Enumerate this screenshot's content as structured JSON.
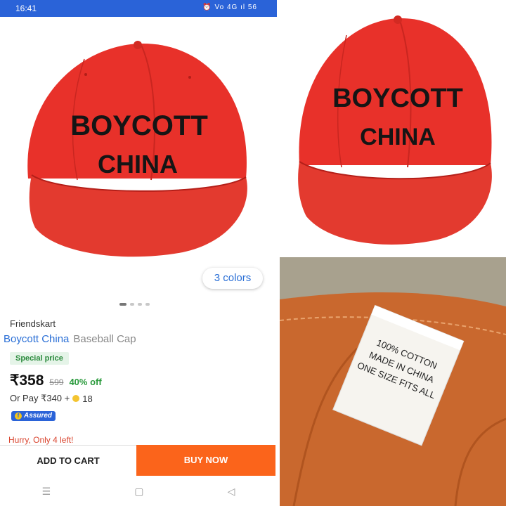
{
  "status_bar": {
    "time": "16:41",
    "icons": "⏰ Vo 4G ıl 56"
  },
  "product": {
    "colors_label": "3 colors",
    "brand": "Friendskart",
    "title_primary": "Boycott China",
    "title_secondary": "Baseball Cap",
    "special_price_label": "Special price",
    "price": "₹358",
    "mrp": "599",
    "discount": "40% off",
    "or_pay_prefix": "Or Pay ₹340 +",
    "coins": "18",
    "assured_label": "Assured",
    "stock_warning": "Hurry, Only 4 left!",
    "carousel_dots": 4,
    "carousel_active": 0
  },
  "actions": {
    "add_to_cart": "ADD TO CART",
    "buy_now": "BUY NOW"
  },
  "cap_print": {
    "line1": "BOYCOTT",
    "line2": "CHINA"
  },
  "label_tag": {
    "line1": "100% COTTON",
    "line2": "MADE IN CHINA",
    "line3": "ONE SIZE FITS ALL"
  },
  "nav_icons": [
    "menu-icon",
    "home-square-icon",
    "back-triangle-icon"
  ],
  "colors": {
    "accent_blue": "#2a63d8",
    "buy_orange": "#fb641b",
    "cap_red": "#e8312a",
    "tag_orange": "#c9682e"
  }
}
